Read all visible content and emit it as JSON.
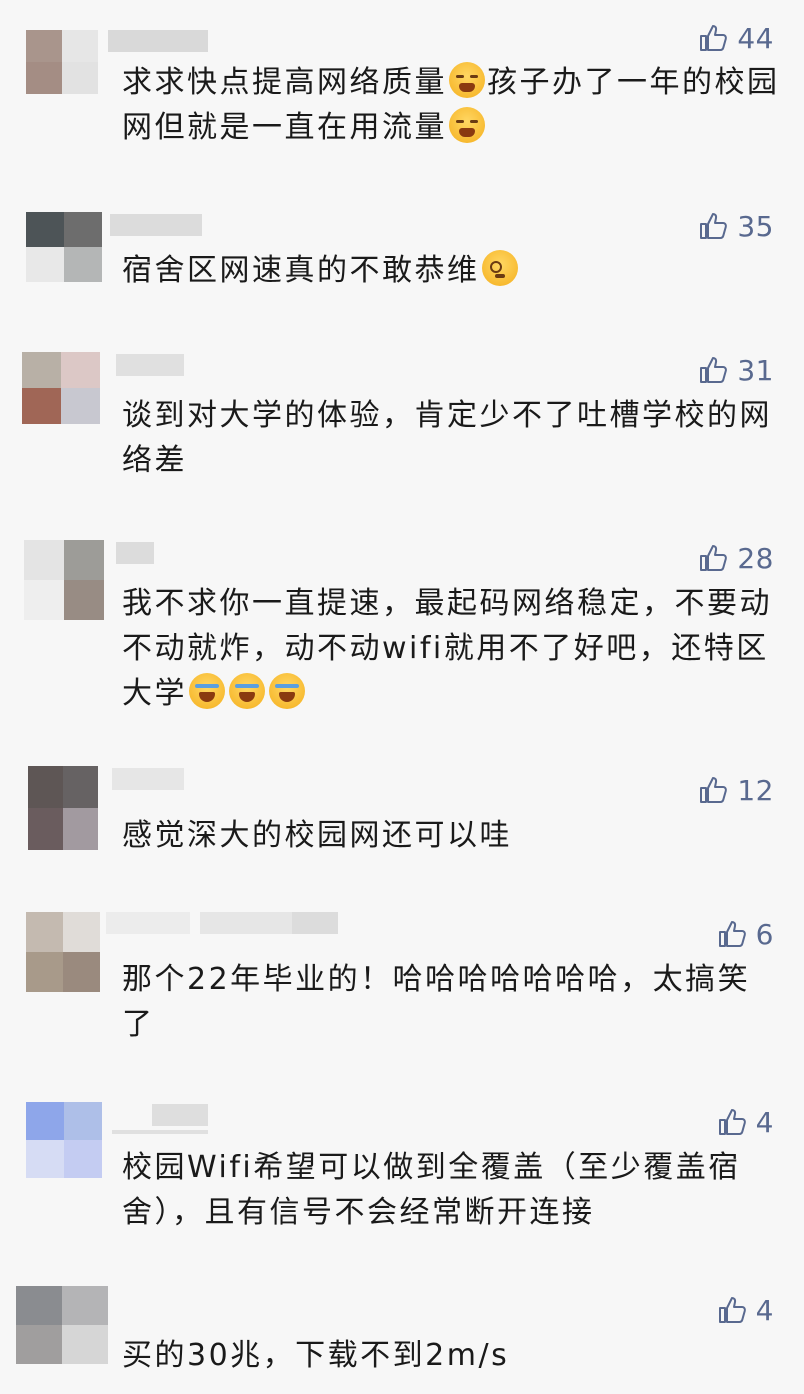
{
  "colors": {
    "background": "#f7f7f7",
    "text": "#1a1a1a",
    "like": "#59698f"
  },
  "comments": [
    {
      "likes": "44",
      "text_before": "求求快点提高网络质量",
      "emoji1": "cry-icon",
      "text_middle": "孩子办了一年的校园网但就是一直在用流量",
      "emoji2": "cry-icon"
    },
    {
      "likes": "35",
      "text_before": "宿舍区网速真的不敢恭维",
      "emoji1": "dizzy-face-icon"
    },
    {
      "likes": "31",
      "text": "谈到对大学的体验，肯定少不了吐槽学校的网络差"
    },
    {
      "likes": "28",
      "text": "我不求你一直提速，最起码网络稳定，不要动不动就炸，动不动wifi就用不了好吧，还特区大学",
      "emojis": [
        "laugh-cry-icon",
        "laugh-cry-icon",
        "laugh-cry-icon"
      ]
    },
    {
      "likes": "12",
      "text": "感觉深大的校园网还可以哇"
    },
    {
      "likes": "6",
      "text": "那个22年毕业的！哈哈哈哈哈哈哈，太搞笑了"
    },
    {
      "likes": "4",
      "text": "校园Wifi希望可以做到全覆盖（至少覆盖宿舍），且有信号不会经常断开连接"
    },
    {
      "likes": "4",
      "text": "买的30兆，下载不到2m/s"
    }
  ]
}
